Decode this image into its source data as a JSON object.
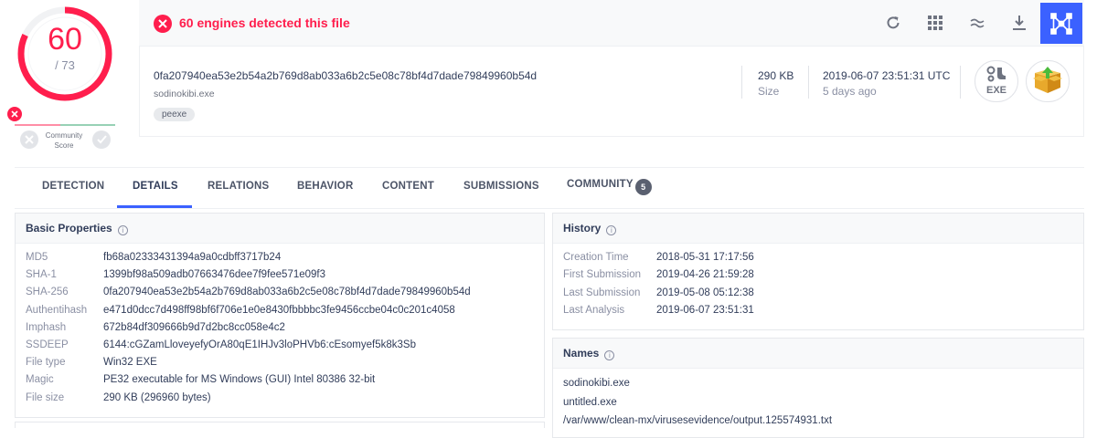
{
  "score": {
    "detected": "60",
    "total": "/ 73",
    "ring_color": "#ff1e4d"
  },
  "community": {
    "label_line1": "Community",
    "label_line2": "Score"
  },
  "header": {
    "detection_text": "60 engines detected this file",
    "accent": "#3b61ff",
    "tools": [
      "refresh-icon",
      "similar-grid-icon",
      "approx-icon",
      "download-icon",
      "graph-icon"
    ]
  },
  "file": {
    "sha256": "0fa207940ea53e2b54a2b769d8ab033a6b2c5e08c78bf4d7dade79849960b54d",
    "name": "sodinokibi.exe",
    "tag": "peexe",
    "size_value": "290 KB",
    "size_label": "Size",
    "date_value": "2019-06-07 23:51:31 UTC",
    "date_label": "5 days ago",
    "type_icon_label": "EXE"
  },
  "tabs": [
    {
      "label": "DETECTION"
    },
    {
      "label": "DETAILS"
    },
    {
      "label": "RELATIONS"
    },
    {
      "label": "BEHAVIOR"
    },
    {
      "label": "CONTENT"
    },
    {
      "label": "SUBMISSIONS"
    },
    {
      "label": "COMMUNITY",
      "badge": "5"
    }
  ],
  "basic": {
    "title": "Basic Properties",
    "rows": [
      {
        "k": "MD5",
        "v": "fb68a02333431394a9a0cdbff3717b24"
      },
      {
        "k": "SHA-1",
        "v": "1399bf98a509adb07663476dee7f9fee571e09f3"
      },
      {
        "k": "SHA-256",
        "v": "0fa207940ea53e2b54a2b769d8ab033a6b2c5e08c78bf4d7dade79849960b54d"
      },
      {
        "k": "Authentihash",
        "v": "e471d0dcc7d498ff98bf6f706e1e0e8430fbbbbc3fe9456ccbe04c0c201c4058"
      },
      {
        "k": "Imphash",
        "v": "672b84df309666b9d7d2bc8cc058e4c2"
      },
      {
        "k": "SSDEEP",
        "v": "6144:cGZamLloveyefyOrA80qE1IHJv3loPHVb6:cEsomyef5k8k3Sb"
      },
      {
        "k": "File type",
        "v": "Win32 EXE"
      },
      {
        "k": "Magic",
        "v": "PE32 executable for MS Windows (GUI) Intel 80386 32-bit"
      },
      {
        "k": "File size",
        "v": "290 KB (296960 bytes)"
      }
    ]
  },
  "history": {
    "title": "History",
    "rows": [
      {
        "k": "Creation Time",
        "v": "2018-05-31 17:17:56"
      },
      {
        "k": "First Submission",
        "v": "2019-04-26 21:59:28"
      },
      {
        "k": "Last Submission",
        "v": "2019-05-08 05:12:38"
      },
      {
        "k": "Last Analysis",
        "v": "2019-06-07 23:51:31"
      }
    ]
  },
  "names": {
    "title": "Names",
    "items": [
      "sodinokibi.exe",
      "untitled.exe",
      "/var/www/clean-mx/virusesevidence/output.125574931.txt"
    ]
  }
}
